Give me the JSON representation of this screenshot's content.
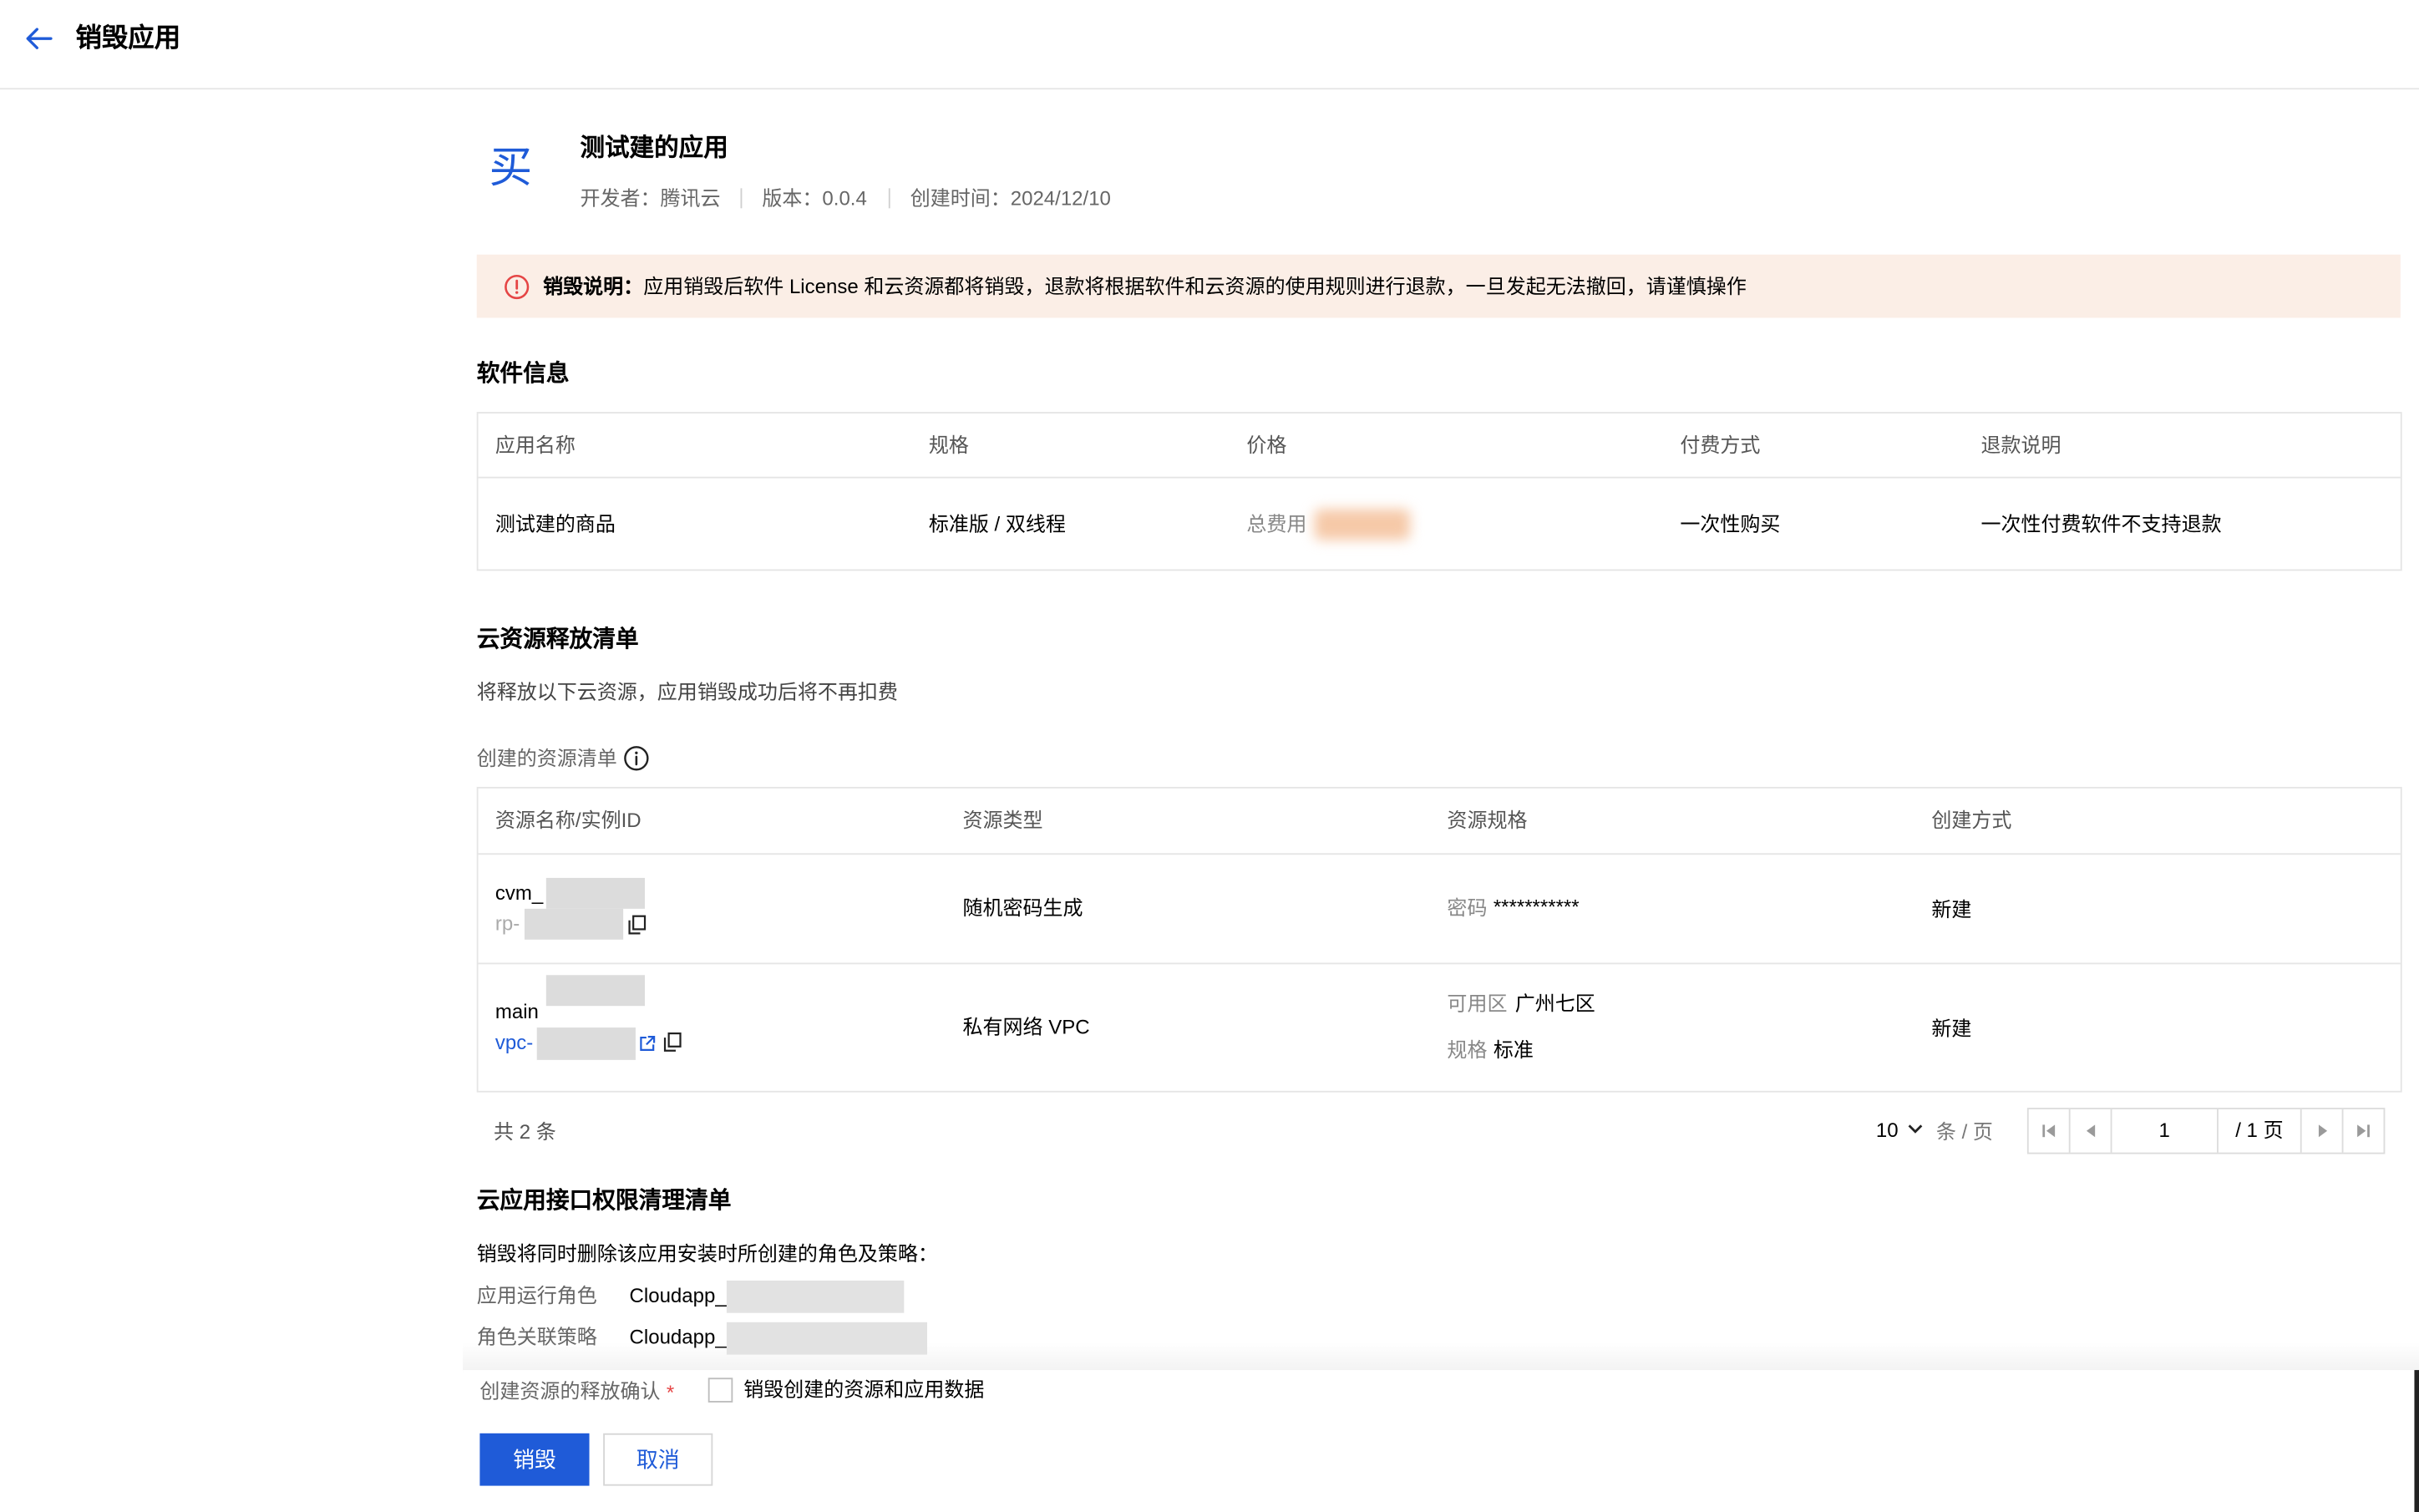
{
  "header": {
    "title": "销毁应用"
  },
  "app": {
    "logo_char": "买",
    "name": "测试建的应用",
    "developer": "开发者：腾讯云",
    "version": "版本：0.0.4",
    "created": "创建时间：2024/12/10"
  },
  "notice": {
    "label": "销毁说明：",
    "text": "应用销毁后软件 License 和云资源都将销毁，退款将根据软件和云资源的使用规则进行退款，一旦发起无法撤回，请谨慎操作"
  },
  "software": {
    "title": "软件信息",
    "headers": [
      "应用名称",
      "规格",
      "价格",
      "付费方式",
      "退款说明"
    ],
    "row": {
      "name": "测试建的商品",
      "spec": "标准版 / 双线程",
      "price_label": "总费用",
      "pay": "一次性购买",
      "refund": "一次性付费软件不支持退款"
    }
  },
  "cloud": {
    "title": "云资源释放清单",
    "desc": "将释放以下云资源，应用销毁成功后将不再扣费",
    "list_label": "创建的资源清单",
    "headers": [
      "资源名称/实例ID",
      "资源类型",
      "资源规格",
      "创建方式"
    ],
    "rows": [
      {
        "name": "cvm_",
        "id": "rp-",
        "type": "随机密码生成",
        "spec_label": "密码",
        "spec_value": "***********",
        "method": "新建"
      },
      {
        "name": "main",
        "id": "vpc-",
        "type": "私有网络 VPC",
        "zone_label": "可用区",
        "zone_value": "广州七区",
        "spec_label": "规格",
        "spec_value": "标准",
        "method": "新建"
      }
    ],
    "total": "共 2 条",
    "page_size": "10",
    "per_page": "条 / 页",
    "page": "1",
    "page_total": "/ 1 页"
  },
  "perm": {
    "title": "云应用接口权限清理清单",
    "desc": "销毁将同时删除该应用安装时所创建的角色及策略：",
    "items": [
      {
        "label": "应用运行角色",
        "value": "Cloudapp_"
      },
      {
        "label": "角色关联策略",
        "value": "Cloudapp_"
      }
    ]
  },
  "confirm": {
    "label": "创建资源的释放确认",
    "required": "*",
    "checkbox_label": "销毁创建的资源和应用数据"
  },
  "buttons": {
    "destroy": "销毁",
    "cancel": "取消"
  },
  "colors": {
    "primary": "#1f5bd8",
    "notice_bg": "#fbeee6",
    "danger": "#e54545"
  }
}
